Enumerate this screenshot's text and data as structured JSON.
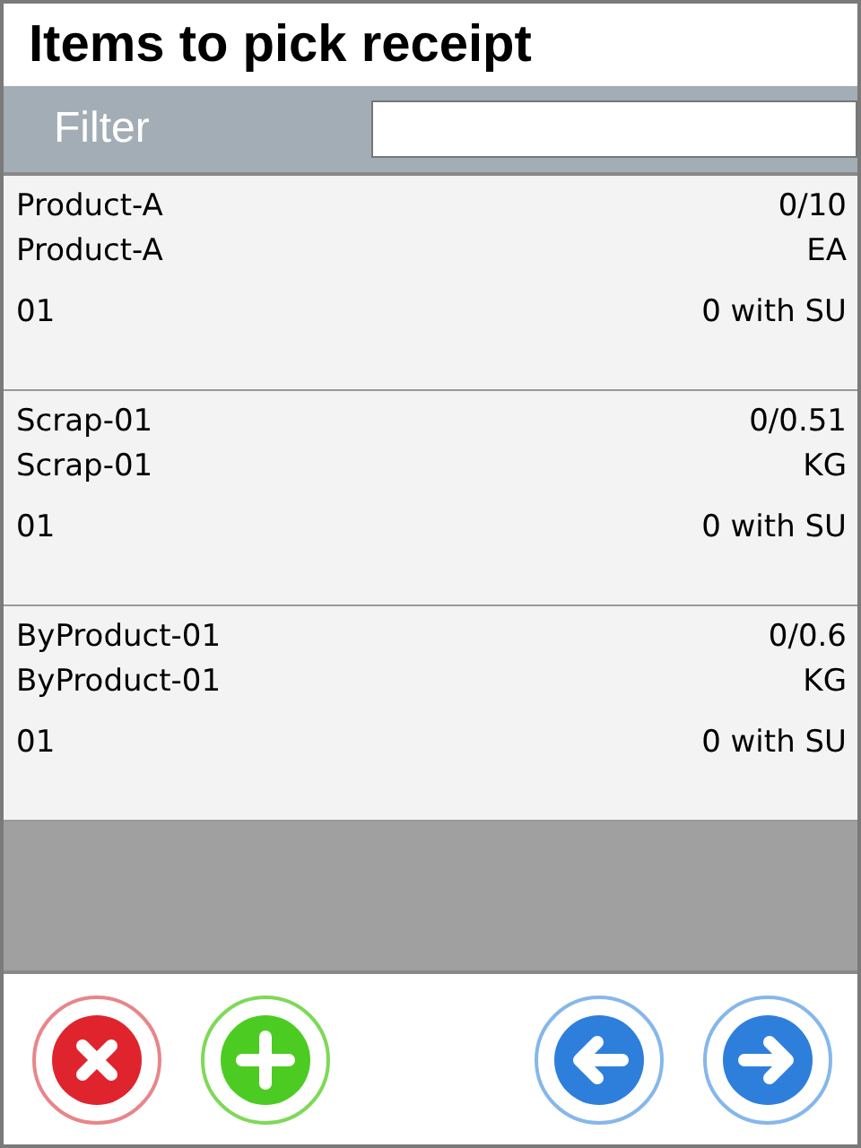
{
  "title": "Items to pick receipt",
  "filter": {
    "label": "Filter"
  },
  "items": [
    {
      "name": "Product-A",
      "quantity": "0/10",
      "description": "Product-A",
      "unit": "EA",
      "code": "01",
      "su": "0 with SU"
    },
    {
      "name": "Scrap-01",
      "quantity": "0/0.51",
      "description": "Scrap-01",
      "unit": "KG",
      "code": "01",
      "su": "0 with SU"
    },
    {
      "name": "ByProduct-01",
      "quantity": "0/0.6",
      "description": "ByProduct-01",
      "unit": "KG",
      "code": "01",
      "su": "0 with SU"
    }
  ],
  "buttons": [
    {
      "kind": "cancel"
    },
    {
      "kind": "add"
    },
    {
      "kind": "back"
    },
    {
      "kind": "forward"
    }
  ]
}
